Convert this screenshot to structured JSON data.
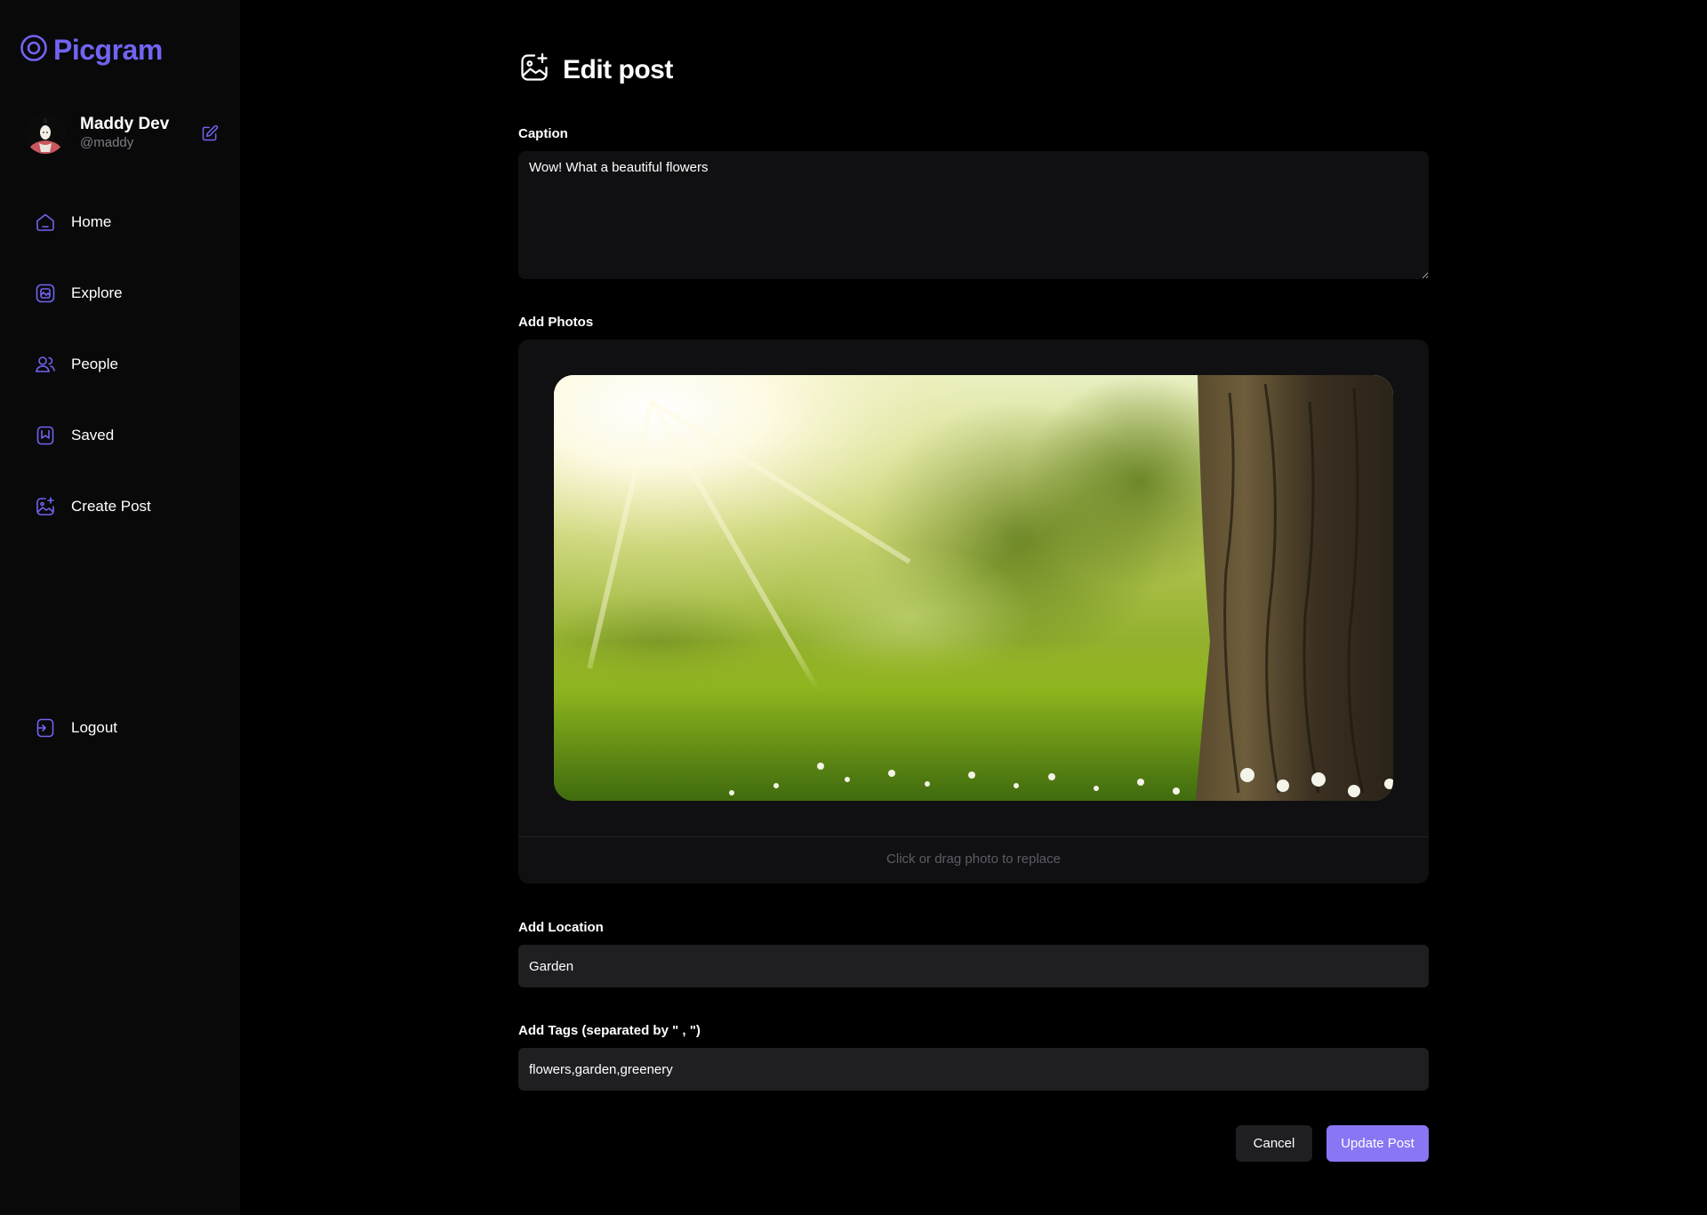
{
  "app": {
    "name": "Picgram",
    "accent_color": "#7064f0"
  },
  "profile": {
    "name": "Maddy Dev",
    "handle": "@maddy",
    "avatar_icon": "user-avatar",
    "edit_icon": "edit-icon"
  },
  "sidebar": {
    "items": [
      {
        "label": "Home",
        "icon": "home-icon"
      },
      {
        "label": "Explore",
        "icon": "explore-icon"
      },
      {
        "label": "People",
        "icon": "people-icon"
      },
      {
        "label": "Saved",
        "icon": "bookmark-icon"
      },
      {
        "label": "Create Post",
        "icon": "gallery-add-icon"
      }
    ],
    "logout": {
      "label": "Logout",
      "icon": "logout-icon"
    }
  },
  "page": {
    "title": "Edit post",
    "icon": "gallery-add-icon"
  },
  "form": {
    "caption": {
      "label": "Caption",
      "value": "Wow! What a beautiful flowers"
    },
    "photos": {
      "label": "Add Photos",
      "hint": "Click or drag photo to replace"
    },
    "location": {
      "label": "Add Location",
      "value": "Garden"
    },
    "tags": {
      "label": "Add Tags (separated by \" , \")",
      "value": "flowers,garden,greenery"
    },
    "cancel_label": "Cancel",
    "submit_label": "Update Post"
  },
  "colors": {
    "background": "#000000",
    "sidebar": "#09090a",
    "input": "#1f1f22",
    "primary_button": "#8876f4"
  }
}
